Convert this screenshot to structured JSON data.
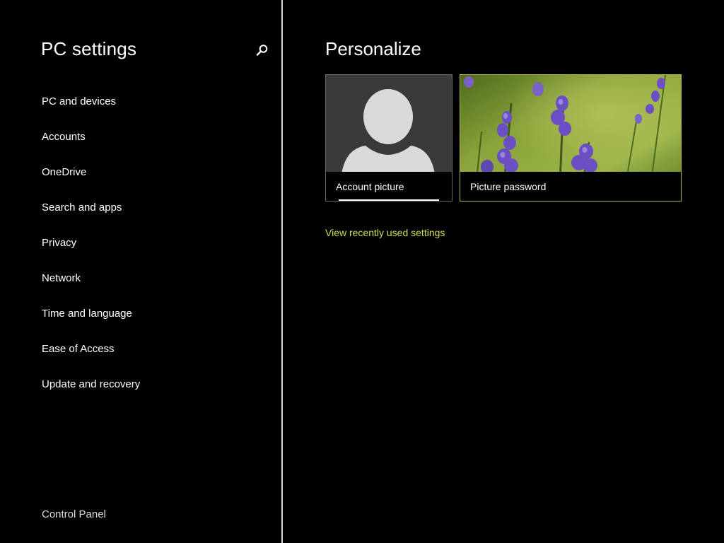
{
  "app": {
    "title": "PC settings"
  },
  "sidebar": {
    "items": [
      {
        "label": "PC and devices"
      },
      {
        "label": "Accounts"
      },
      {
        "label": "OneDrive"
      },
      {
        "label": "Search and apps"
      },
      {
        "label": "Privacy"
      },
      {
        "label": "Network"
      },
      {
        "label": "Time and language"
      },
      {
        "label": "Ease of Access"
      },
      {
        "label": "Update and recovery"
      }
    ],
    "footer_link": "Control Panel",
    "search_icon": "search-icon"
  },
  "main": {
    "title": "Personalize",
    "tiles": [
      {
        "label": "Account picture",
        "icon": "user-silhouette-icon"
      },
      {
        "label": "Picture password",
        "icon": "lavender-photo"
      }
    ],
    "recent_link": "View recently used settings"
  },
  "colors": {
    "background": "#000000",
    "accent_link": "#d6df55",
    "divider": "#d8d8d8",
    "tile_border_selected": "#b7ae4a"
  }
}
